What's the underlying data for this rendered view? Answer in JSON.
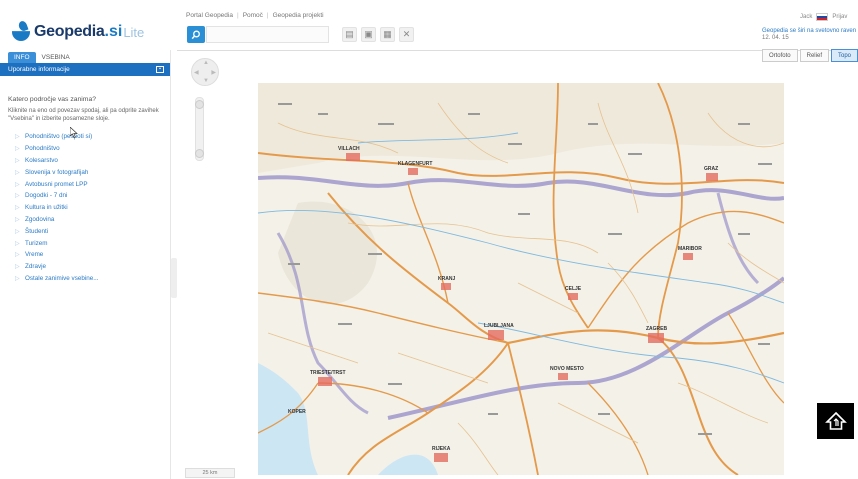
{
  "header": {
    "logo": {
      "name": "Geopedia",
      "si": ".si",
      "lite": "Lite"
    },
    "links": [
      "Portal Geopedia",
      "Pomoč",
      "Geopedia projekti"
    ],
    "user": "Jack",
    "login": "Prijav",
    "news_text": "Geopedia se širi na svetovno raven",
    "news_time": "12. 04. 15"
  },
  "sidebar": {
    "tabs": [
      "INFO",
      "VSEBINA"
    ],
    "panel_title": "Uporabne informacije",
    "question": "Katero področje vas zanima?",
    "description": "Kliknite na eno od povezav spodaj, ali pa odprite zavihek \"Vsebina\" in izberite posamezne sloje.",
    "items": [
      "Pohodništvo (pespoti si)",
      "Pohodništvo",
      "Kolesarstvo",
      "Slovenija v fotografijah",
      "Avtobusni promet LPP",
      "Dogodki - 7 dni",
      "Kultura in užitki",
      "Zgodovina",
      "Študenti",
      "Turizem",
      "Vreme",
      "Zdravje",
      "Ostale zanimive vsebine..."
    ]
  },
  "map": {
    "layers": [
      "Ortofoto",
      "Relief",
      "Topo"
    ],
    "active_layer": "Topo",
    "scale": "25 km",
    "cities": [
      "VILLACH",
      "KLAGENFURT",
      "KRANJ",
      "LJUBLJANA",
      "ZAGREB",
      "TRIESTE/TRST",
      "RIJEKA",
      "GRAZ",
      "MARIBOR",
      "CELJE",
      "NOVO MESTO",
      "KOPER"
    ]
  },
  "colors": {
    "accent": "#1d6fc0",
    "link": "#2b7bc6",
    "road": "#e8a35a",
    "border": "#8c84c4"
  }
}
